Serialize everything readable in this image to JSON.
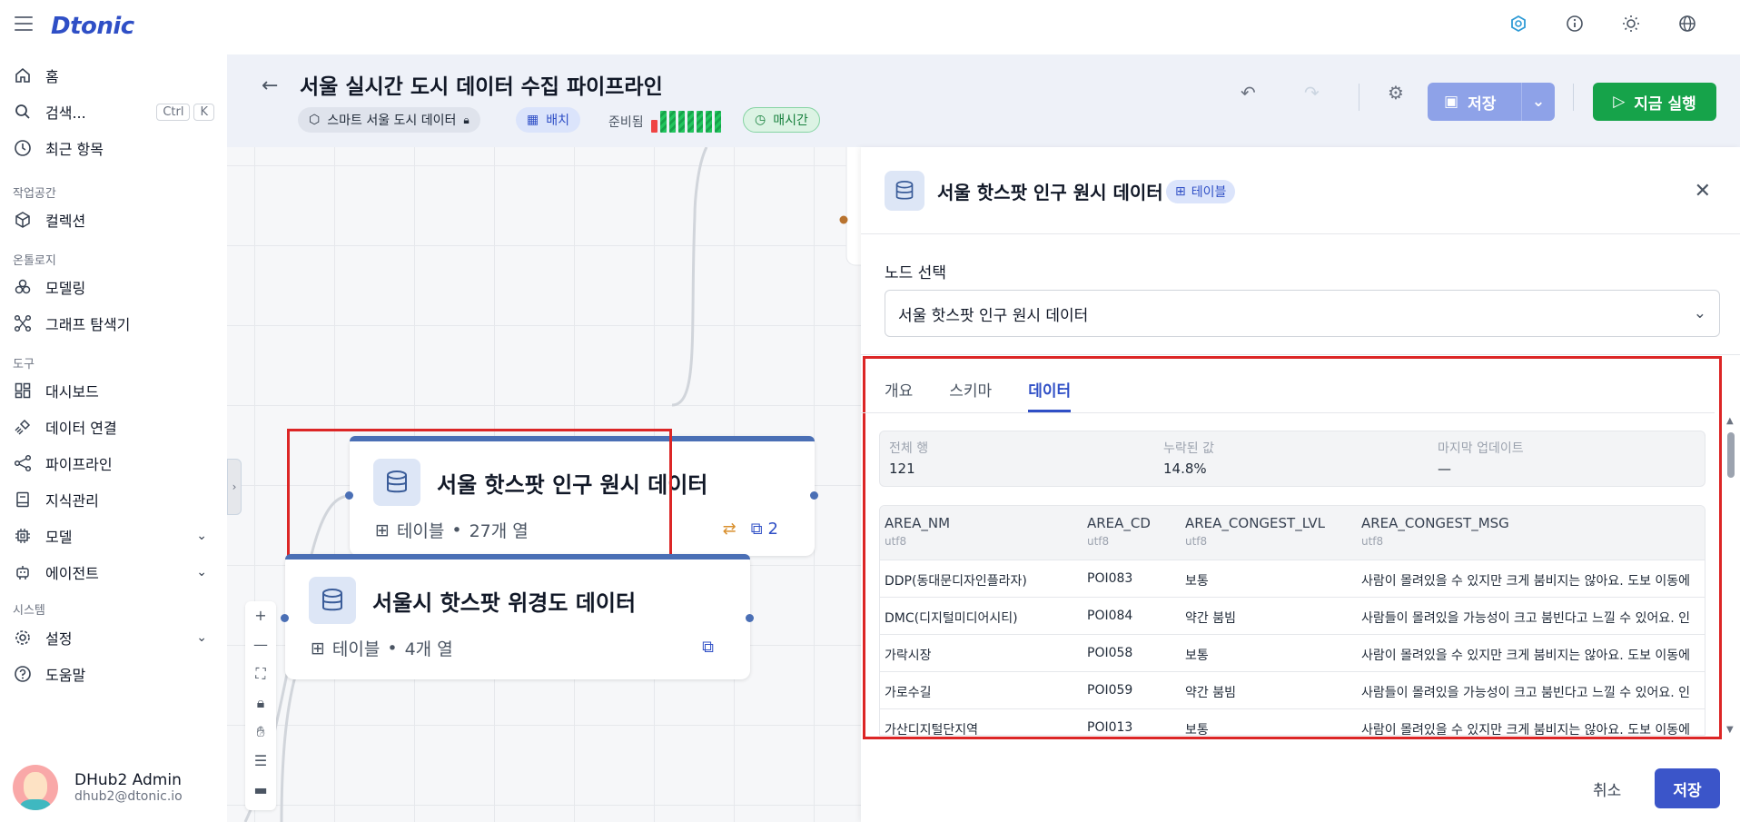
{
  "app": {
    "logo": "Dtonic"
  },
  "sidebar": {
    "home": "홈",
    "search": "검색...",
    "search_kbd1": "Ctrl",
    "search_kbd2": "K",
    "recent": "최근 항목",
    "section_workspace": "작업공간",
    "collection": "컬렉션",
    "section_ontology": "온톨로지",
    "modeling": "모델링",
    "graph_explorer": "그래프 탐색기",
    "section_tools": "도구",
    "dashboard": "대시보드",
    "data_connect": "데이터 연결",
    "pipeline": "파이프라인",
    "knowledge": "지식관리",
    "model": "모델",
    "agent": "에이전트",
    "section_system": "시스템",
    "settings": "설정",
    "help": "도움말"
  },
  "user": {
    "name": "DHub2 Admin",
    "email": "dhub2@dtonic.io"
  },
  "header": {
    "title": "서울 실시간 도시 데이터 수집 파이프라인",
    "chip_project": "스마트 서울 도시 데이터",
    "chip_mode": "배치",
    "ready_label": "준비됨",
    "chip_schedule": "매시간",
    "save_label": "저장",
    "run_label": "지금 실행"
  },
  "nodes": [
    {
      "title": "서울 핫스팟 인구 원시 데이터",
      "type": "테이블",
      "columns": "27개 열",
      "count": "2"
    },
    {
      "title": "서울시 핫스팟 위경도 데이터",
      "type": "테이블",
      "columns": "4개 열"
    }
  ],
  "panel": {
    "title": "서울 핫스팟 인구 원시 데이터",
    "badge": "테이블",
    "node_select_label": "노드 선택",
    "node_select_value": "서울 핫스팟 인구 원시 데이터",
    "tabs": [
      "개요",
      "스키마",
      "데이터"
    ],
    "stats": [
      {
        "label": "전체 행",
        "value": "121"
      },
      {
        "label": "누락된 값",
        "value": "14.8%"
      },
      {
        "label": "마지막 업데이트",
        "value": "—"
      }
    ],
    "columns": [
      {
        "name": "AREA_NM",
        "type": "utf8"
      },
      {
        "name": "AREA_CD",
        "type": "utf8"
      },
      {
        "name": "AREA_CONGEST_LVL",
        "type": "utf8"
      },
      {
        "name": "AREA_CONGEST_MSG",
        "type": "utf8"
      }
    ],
    "rows": [
      [
        "DDP(동대문디자인플라자)",
        "POI083",
        "보통",
        "사람이 몰려있을 수 있지만 크게 붐비지는 않아요. 도보 이동에"
      ],
      [
        "DMC(디지털미디어시티)",
        "POI084",
        "약간 붐빔",
        "사람들이 몰려있을 가능성이 크고 붐빈다고 느낄 수 있어요. 인"
      ],
      [
        "가락시장",
        "POI058",
        "보통",
        "사람이 몰려있을 수 있지만 크게 붐비지는 않아요. 도보 이동에"
      ],
      [
        "가로수길",
        "POI059",
        "약간 붐빔",
        "사람들이 몰려있을 가능성이 크고 붐빈다고 느낄 수 있어요. 인"
      ],
      [
        "가산디지털단지역",
        "POI013",
        "보통",
        "사람이 몰려있을 수 있지만 크게 붐비지는 않아요. 도보 이동에"
      ]
    ],
    "cancel_label": "취소",
    "save_label": "저장"
  },
  "colors": {
    "accent": "#2f4fc6",
    "run": "#16a34a",
    "highlight": "#dc2626"
  }
}
